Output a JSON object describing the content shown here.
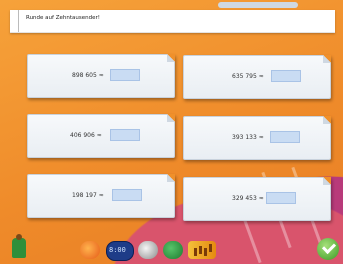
{
  "task": {
    "title": "Runde auf Zehntausender!"
  },
  "exercises": [
    {
      "number": "898 605",
      "sign": "≈"
    },
    {
      "number": "635 795",
      "sign": "≈"
    },
    {
      "number": "406 906",
      "sign": "≈"
    },
    {
      "number": "393 133",
      "sign": "≈"
    },
    {
      "number": "198 197",
      "sign": "≈"
    },
    {
      "number": "329 453",
      "sign": "≈"
    }
  ],
  "toolbar": {
    "clock_display": "8:00"
  }
}
